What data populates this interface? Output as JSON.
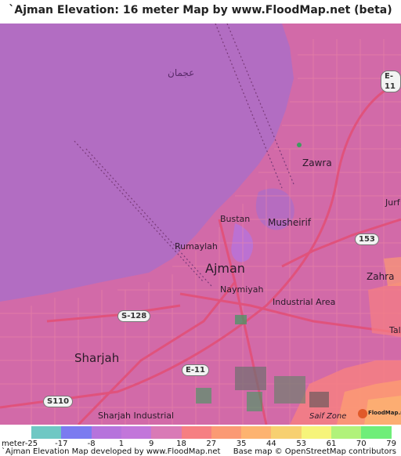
{
  "title": "`Ajman Elevation: 16 meter Map by www.FloodMap.net (beta)",
  "places": {
    "sea_label": "عجمان",
    "zawra": "Zawra",
    "jurf": "Jurf",
    "bustan": "Bustan",
    "musheirif": "Musheirif",
    "rumaylah": "Rumaylah",
    "ajman": "Ajman",
    "naymiyah": "Naymiyah",
    "zahra": "Zahra",
    "industrial_area": "Industrial Area",
    "sharjah": "Sharjah",
    "sharjah_industrial": "Sharjah Industrial",
    "saif_zone": "Saif Zone",
    "tal": "Tal"
  },
  "road_shields": {
    "e11_top": "E-11",
    "e11_bottom": "E-11",
    "s128": "S-128",
    "r153": "153",
    "s110": "S110"
  },
  "legend": {
    "unit_label": "meter",
    "values": [
      "-25",
      "-17",
      "-8",
      "1",
      "9",
      "18",
      "27",
      "35",
      "44",
      "53",
      "61",
      "70",
      "79"
    ],
    "colors": [
      "#6fc8c4",
      "#7b7bf0",
      "#b673dc",
      "#c276da",
      "#d97ab6",
      "#f67f82",
      "#fb9a74",
      "#fdb370",
      "#f7d070",
      "#f6f47a",
      "#b1f27a",
      "#6fee79"
    ]
  },
  "credits": {
    "left": "`Ajman Elevation Map developed by www.FloodMap.net",
    "right": "Base map © OpenStreetMap contributors"
  },
  "watermark": "FloodMap.net",
  "colors": {
    "sea": "#b26dc2",
    "land": "#d26aa8",
    "urban": "#c85f9c",
    "road": "#e06a8a"
  }
}
